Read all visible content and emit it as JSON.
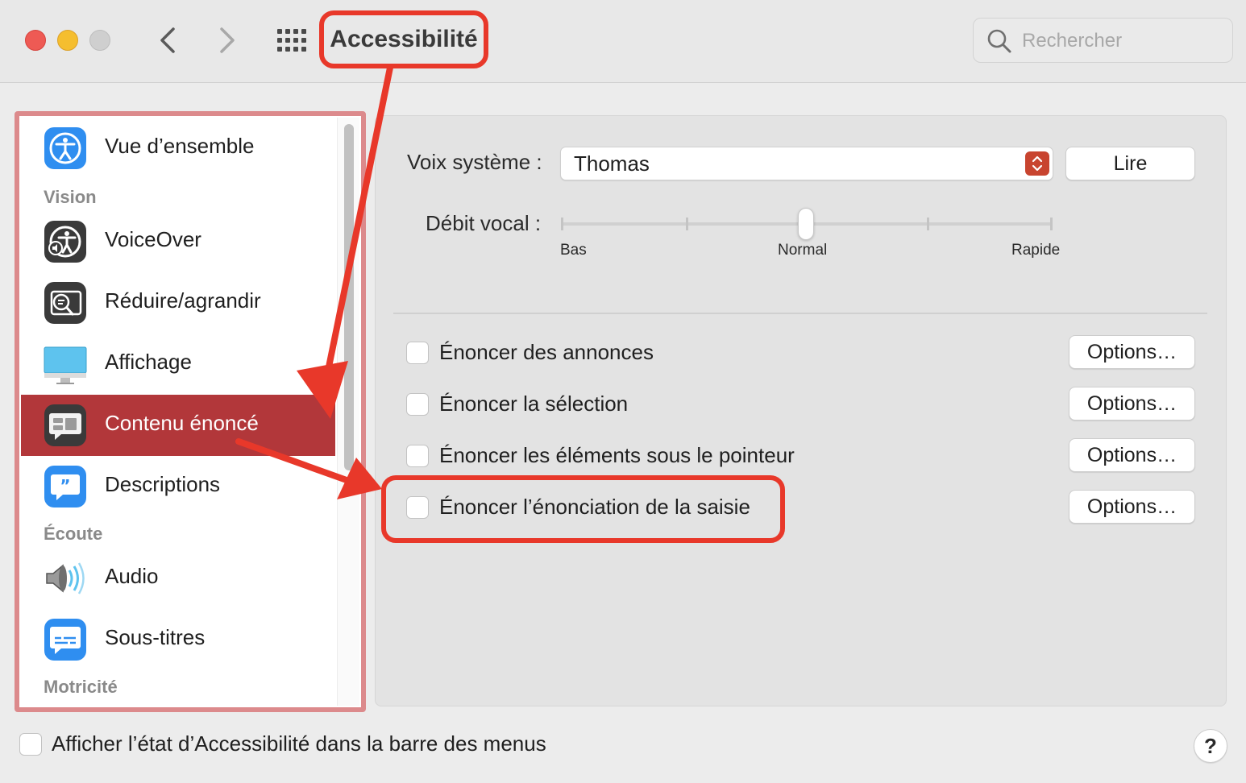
{
  "window": {
    "title": "Accessibilité",
    "search_placeholder": "Rechercher"
  },
  "sidebar": {
    "items": [
      {
        "label": "Vue d’ensemble",
        "icon": "accessibility-icon"
      },
      {
        "label": "VoiceOver",
        "icon": "voiceover-icon"
      },
      {
        "label": "Réduire/agrandir",
        "icon": "zoom-icon"
      },
      {
        "label": "Affichage",
        "icon": "display-icon"
      },
      {
        "label": "Contenu énoncé",
        "icon": "spoken-content-icon",
        "selected": true
      },
      {
        "label": "Descriptions",
        "icon": "descriptions-icon"
      },
      {
        "label": "Audio",
        "icon": "speaker-icon"
      },
      {
        "label": "Sous-titres",
        "icon": "subtitles-icon"
      }
    ],
    "sections": [
      "Vision",
      "Écoute",
      "Motricité"
    ]
  },
  "main": {
    "voice_label": "Voix système :",
    "voice_value": "Thomas",
    "play_button": "Lire",
    "rate_label": "Débit vocal :",
    "rate_ticks": [
      "Bas",
      "Normal",
      "Rapide"
    ],
    "rate_value_fraction": 0.5,
    "options": [
      {
        "label": "Énoncer des annonces",
        "checked": false,
        "button": "Options…"
      },
      {
        "label": "Énoncer la sélection",
        "checked": false,
        "button": "Options…"
      },
      {
        "label": "Énoncer les éléments sous le pointeur",
        "checked": false,
        "button": "Options…"
      },
      {
        "label": "Énoncer l’énonciation de la saisie",
        "checked": false,
        "button": "Options…"
      }
    ]
  },
  "footer": {
    "menu_bar_label": "Afficher l’état d’Accessibilité dans la barre des menus",
    "help": "?"
  },
  "colors": {
    "selection": "#b2373a",
    "annotation": "#e8382a",
    "sidebar_frame": "#dc8a8c"
  }
}
